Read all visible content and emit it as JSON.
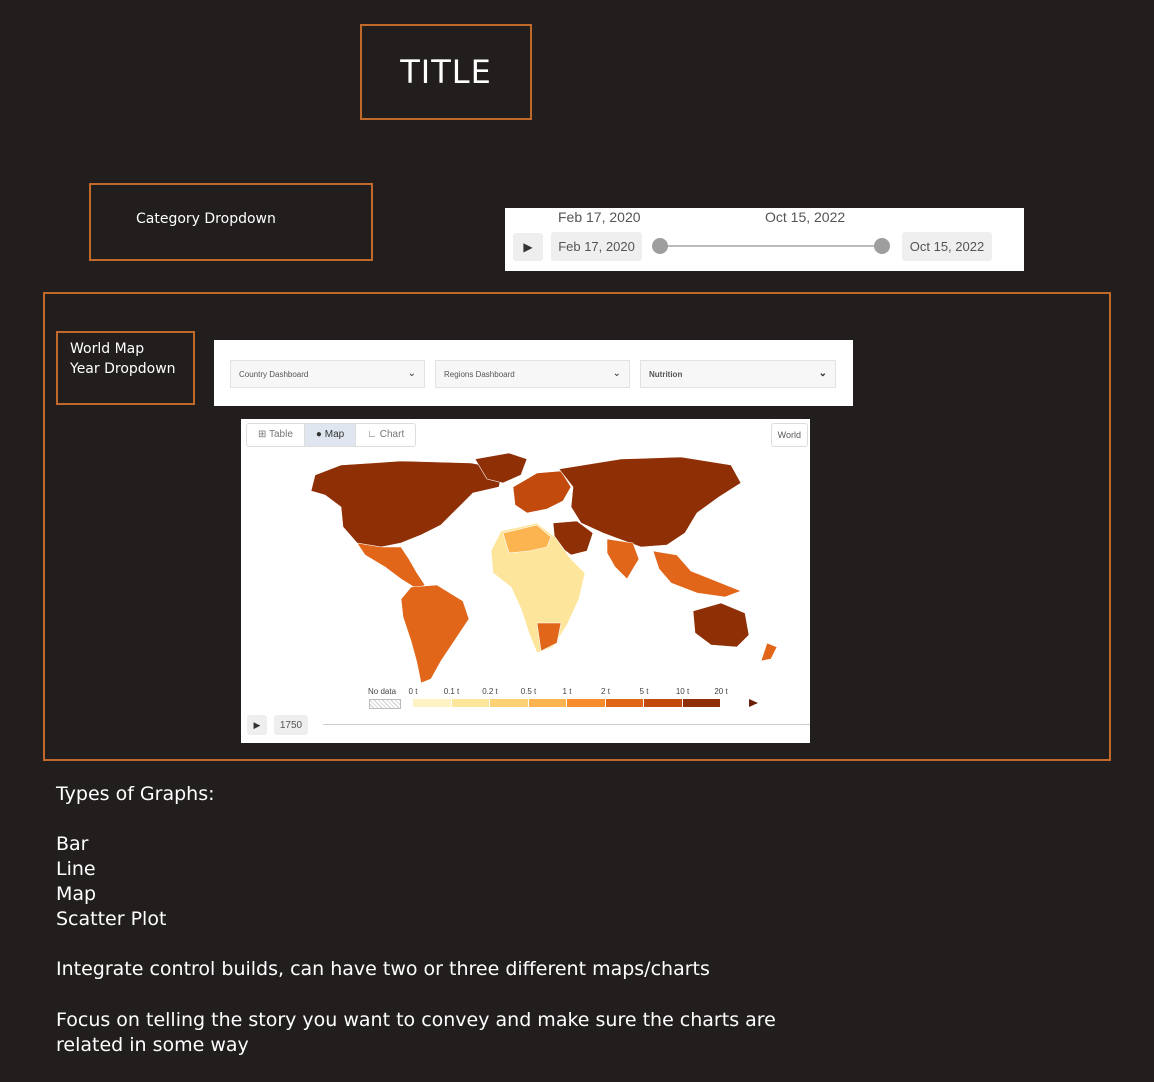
{
  "title": "TITLE",
  "category_dropdown": "Category Dropdown",
  "date_range": {
    "start_label": "Feb 17, 2020",
    "end_label": "Oct 15, 2022",
    "start_chip": "Feb 17, 2020",
    "end_chip": "Oct 15, 2022",
    "play_icon": "play-icon"
  },
  "world_map_box": {
    "line1": "World Map",
    "line2": "Year Dropdown"
  },
  "dashboards": [
    {
      "label": "Country Dashboard"
    },
    {
      "label": "Regions Dashboard"
    },
    {
      "label": "Nutrition"
    }
  ],
  "map_widget": {
    "tabs": [
      "Table",
      "Map",
      "Chart"
    ],
    "active_tab": "Map",
    "region_button": "World",
    "legend": {
      "no_data": "No data",
      "ticks": [
        "0 t",
        "0.1 t",
        "0.2 t",
        "0.5 t",
        "1 t",
        "2 t",
        "5 t",
        "10 t",
        "20 t"
      ],
      "colors": [
        "#fdf2c4",
        "#fde59b",
        "#fdd274",
        "#fbb44f",
        "#f68c2c",
        "#e1661a",
        "#c24a0d",
        "#8e2f06"
      ]
    },
    "year": "1750",
    "colors": {
      "dark": "#8e2f06",
      "mid": "#c24a0d",
      "orange": "#e1661a",
      "light": "#fbb44f",
      "pale": "#fde59b"
    }
  },
  "notes": {
    "heading": "Types of Graphs:",
    "items": [
      "Bar",
      "Line",
      "Map",
      "Scatter Plot"
    ],
    "line1": "Integrate control builds, can have two or three different maps/charts",
    "line2a": "Focus on telling the story you want to convey and make sure the charts are",
    "line2b": "related in some way"
  }
}
